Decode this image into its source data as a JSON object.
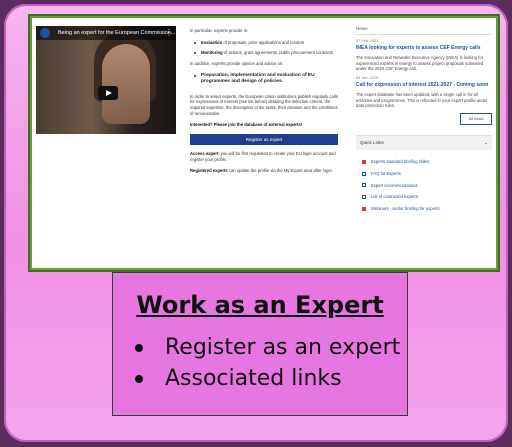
{
  "video": {
    "title": "Being an expert for the European Commission..."
  },
  "middle": {
    "intro": "In particular, experts provide in:",
    "bullets1": [
      {
        "bold": "Evaluation",
        "text": " of proposals, prize applications and tenders"
      },
      {
        "bold": "Monitoring",
        "text": " of actions, grant agreements, public procurement contracts"
      }
    ],
    "advice": "In addition, experts provide opinion and advice on:",
    "bullets2": [
      {
        "text": "Preparation, implementation and evaluation of EU programmes and design of policies."
      }
    ],
    "selection": "In order to select experts, the European Union institutions publish regularly calls for expressions of interest (see list below) detailing the selection criteria, the required expertise, the description of the tasks, their duration and the conditions of remuneration.",
    "interested": "Interested? Please join the database of external experts!",
    "register_label": "Register as expert",
    "access": {
      "bold": "Access expert",
      "text": ": you will be first requested to create your EU login account and register your profile."
    },
    "registered": {
      "bold": "Registered experts",
      "text": " can update the profile via the My Expert area after login."
    }
  },
  "news": {
    "heading": "News",
    "items": [
      {
        "date": "17 Feb. 2021",
        "title": "INEA looking for experts to assess CEF Energy calls",
        "desc": "The Innovation and Networks Executive Agency (INEA) is looking for experienced experts in energy to assess project proposals submitted under the 2020 CEF Energy call."
      },
      {
        "date": "04 Jun. 2020",
        "title": "Call for expression of interest 2021-2027 - Coming soon",
        "desc": "The expert database has been updated, with a single call in for all activities and programmes. This is reflected in your expert profile under data protection rules."
      }
    ],
    "all_news": "All news"
  },
  "quick_links": {
    "heading": "Quick Links",
    "items": [
      {
        "label": "Experts standard briefing slides",
        "icon": "pdf-icon"
      },
      {
        "label": "FAQ for Experts",
        "icon": "external-link-icon"
      },
      {
        "label": "Expert recommendations",
        "icon": "external-link-icon"
      },
      {
        "label": "List of contracted experts",
        "icon": "external-link-icon"
      },
      {
        "label": "Webinars - sector briefing for experts",
        "icon": "pdf-icon"
      }
    ]
  },
  "slide": {
    "heading": "Work as an Expert",
    "bullets": [
      "Register as an expert",
      "Associated links"
    ]
  },
  "colors": {
    "background": "#5a2d5e",
    "card": "#ef8fe6",
    "textbox": "#e777e0",
    "link": "#1f4fa3",
    "button": "#1f3f8e",
    "frame": "#6a9a3a"
  }
}
